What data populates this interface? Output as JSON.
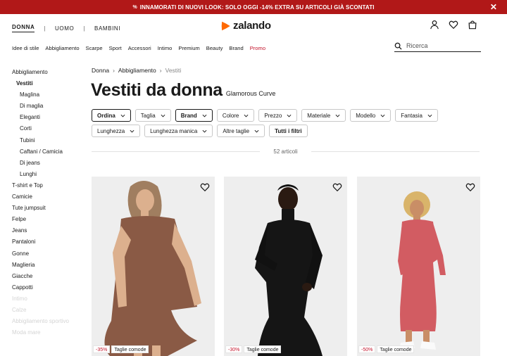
{
  "promo_bar": {
    "text": "INNAMORATI DI NUOVI LOOK: SOLO OGGI -14% EXTRA SU ARTICOLI GIÀ SCONTATI",
    "icon": "percent-icon",
    "close_icon": "close-icon",
    "background": "#b11818"
  },
  "gender_nav": [
    {
      "label": "DONNA",
      "active": true
    },
    {
      "label": "UOMO",
      "active": false
    },
    {
      "label": "BAMBINI",
      "active": false
    }
  ],
  "logo": {
    "text": "zalando",
    "icon": "zalando-logo-icon",
    "color": "#ff6900"
  },
  "header_icons": [
    "user-icon",
    "heart-icon",
    "bag-icon"
  ],
  "category_nav": [
    "Idee di stile",
    "Abbigliamento",
    "Scarpe",
    "Sport",
    "Accessori",
    "Intimo",
    "Premium",
    "Beauty",
    "Brand",
    "Promo"
  ],
  "search": {
    "placeholder": "Ricerca",
    "value": "",
    "icon": "search-icon"
  },
  "sidebar": [
    {
      "label": "Abbigliamento",
      "level": 0
    },
    {
      "label": "Vestiti",
      "level": 1,
      "bold": true
    },
    {
      "label": "Maglina",
      "level": 2
    },
    {
      "label": "Di maglia",
      "level": 2
    },
    {
      "label": "Eleganti",
      "level": 2
    },
    {
      "label": "Corti",
      "level": 2
    },
    {
      "label": "Tubini",
      "level": 2
    },
    {
      "label": "Caftani / Camicia",
      "level": 2
    },
    {
      "label": "Di jeans",
      "level": 2
    },
    {
      "label": "Lunghi",
      "level": 2
    },
    {
      "label": "T-shirt e Top",
      "level": 0
    },
    {
      "label": "Camicie",
      "level": 0
    },
    {
      "label": "Tute jumpsuit",
      "level": 0
    },
    {
      "label": "Felpe",
      "level": 0
    },
    {
      "label": "Jeans",
      "level": 0
    },
    {
      "label": "Pantaloni",
      "level": 0
    },
    {
      "label": "Gonne",
      "level": 0
    },
    {
      "label": "Maglieria",
      "level": 0
    },
    {
      "label": "Giacche",
      "level": 0
    },
    {
      "label": "Cappotti",
      "level": 0
    },
    {
      "label": "Intimo",
      "level": 0,
      "faded": true
    },
    {
      "label": "Calze",
      "level": 0,
      "faded": true
    },
    {
      "label": "Abbigliamento sportivo",
      "level": 0,
      "faded": true
    },
    {
      "label": "Moda mare",
      "level": 0,
      "faded": true
    }
  ],
  "breadcrumb": [
    "Donna",
    "Abbigliamento",
    "Vestiti"
  ],
  "page": {
    "title": "Vestiti da donna",
    "subtitle": "Glamorous Curve"
  },
  "filters": [
    {
      "label": "Ordina",
      "style": "strong"
    },
    {
      "label": "Taglia"
    },
    {
      "label": "Brand",
      "style": "strong"
    },
    {
      "label": "Colore"
    },
    {
      "label": "Prezzo"
    },
    {
      "label": "Materiale"
    },
    {
      "label": "Modello"
    },
    {
      "label": "Fantasia"
    },
    {
      "label": "Lunghezza"
    },
    {
      "label": "Lunghezza manica"
    },
    {
      "label": "Altre taglie"
    },
    {
      "label": "Tutti i filtri",
      "style": "nochev"
    }
  ],
  "article_count": "52 articoli",
  "products": [
    {
      "discount": "-35%",
      "tag": "Taglie comode",
      "dress_color": "#8a5a45"
    },
    {
      "discount": "-30%",
      "tag": "Taglie comode",
      "dress_color": "#151515"
    },
    {
      "discount": "-50%",
      "tag": "Taglie comode",
      "dress_color": "#d25c62"
    }
  ]
}
